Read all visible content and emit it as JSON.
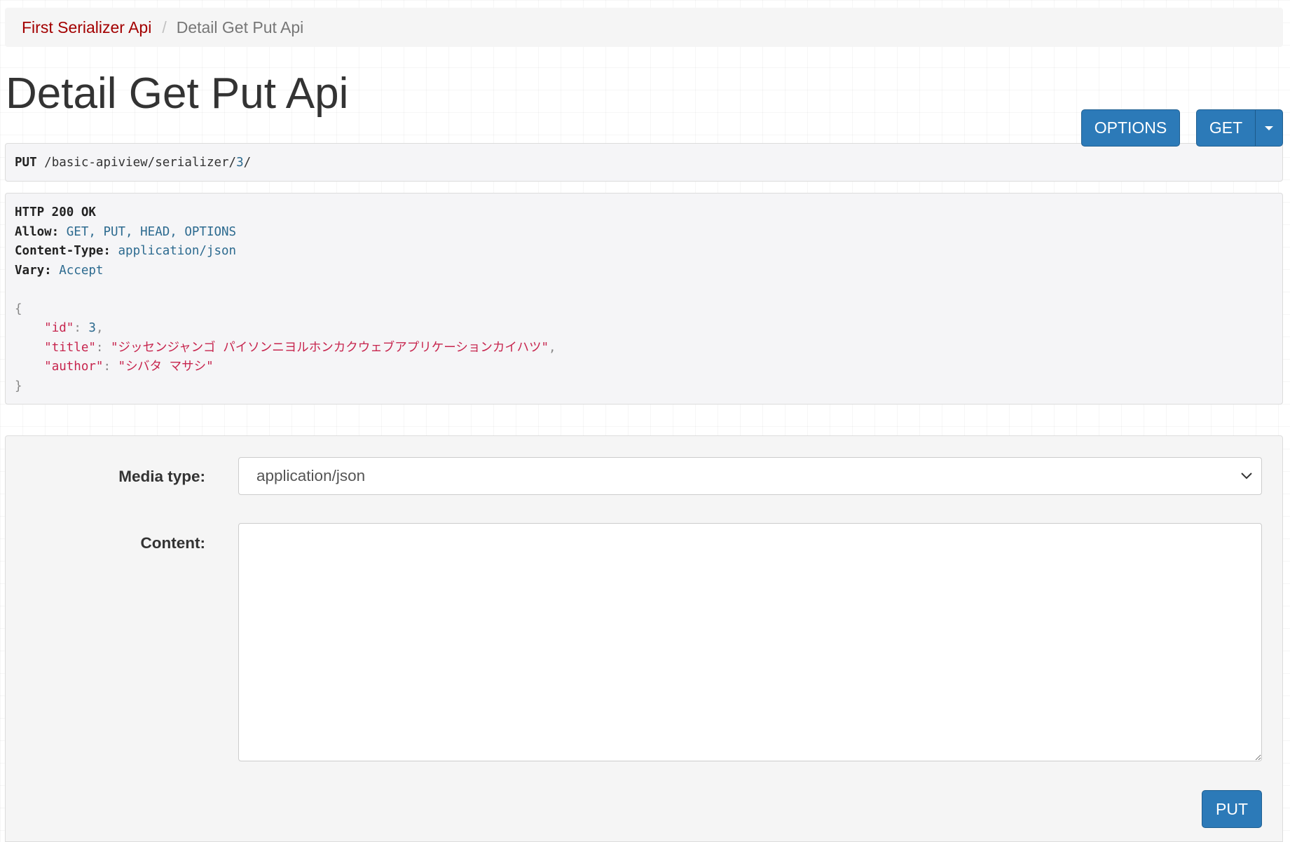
{
  "breadcrumb": {
    "items": [
      "First Serializer Api",
      "Detail Get Put Api"
    ],
    "separator": "/"
  },
  "header": {
    "title": "Detail Get Put Api",
    "options_label": "OPTIONS",
    "get_label": "GET"
  },
  "request": {
    "method": "PUT",
    "path_prefix": "/basic-apiview/serializer/",
    "path_id": "3",
    "path_suffix": "/"
  },
  "response": {
    "status": "HTTP 200 OK",
    "headers": [
      {
        "key": "Allow:",
        "value": "GET, PUT, HEAD, OPTIONS"
      },
      {
        "key": "Content-Type:",
        "value": "application/json"
      },
      {
        "key": "Vary:",
        "value": "Accept"
      }
    ],
    "body": {
      "open_brace": "{",
      "close_brace": "}",
      "fields": [
        {
          "key": "\"id\"",
          "value": "3",
          "trailing": ","
        },
        {
          "key": "\"title\"",
          "value": "\"ジッセンジャンゴ パイソンニヨルホンカクウェブアプリケーションカイハツ\"",
          "trailing": ","
        },
        {
          "key": "\"author\"",
          "value": "\"シバタ マサシ\"",
          "trailing": ""
        }
      ]
    }
  },
  "form": {
    "media_type_label": "Media type:",
    "media_type_value": "application/json",
    "content_label": "Content:",
    "content_value": "",
    "submit_label": "PUT"
  },
  "colors": {
    "primary_button": "#2c7ab8",
    "breadcrumb_link": "#a30000",
    "json_string": "#c7254e",
    "header_value": "#2c6a8f"
  },
  "icons": {
    "get_dropdown": "caret-down-icon",
    "select_dropdown": "chevron-down-icon"
  }
}
